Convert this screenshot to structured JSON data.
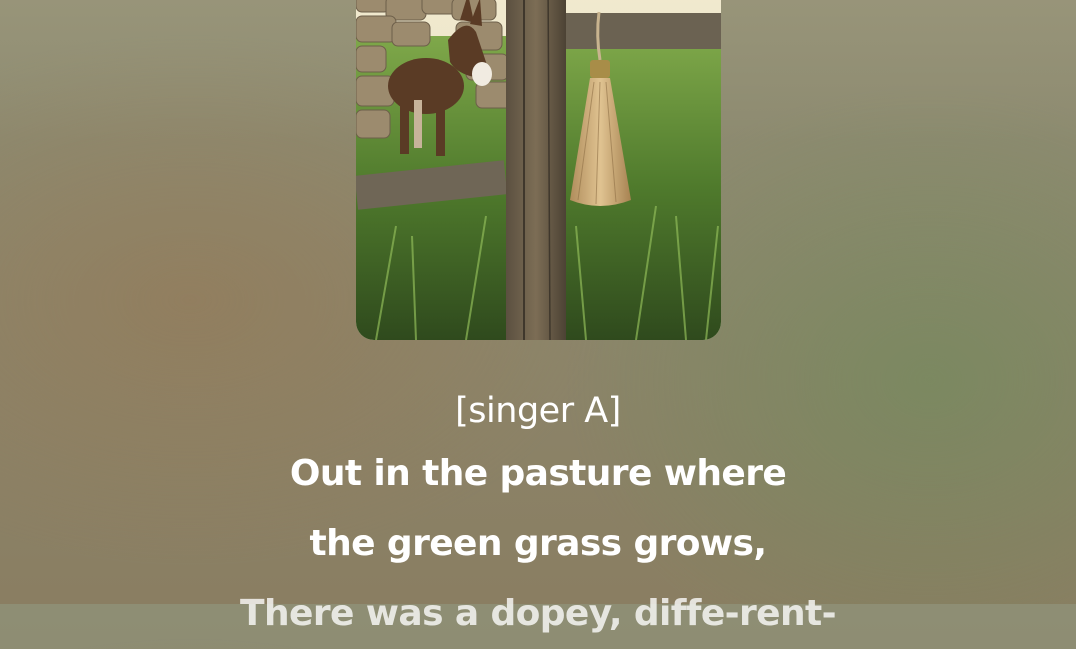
{
  "artwork": {
    "alt_icon": "album-artwork-donkey-fence"
  },
  "lyrics": {
    "tag": "[singer A]",
    "lines": [
      "Out in the pasture where",
      "the green grass grows,",
      "There was a dopey, diffe-rent-"
    ]
  },
  "colors": {
    "text": "#ffffff"
  }
}
